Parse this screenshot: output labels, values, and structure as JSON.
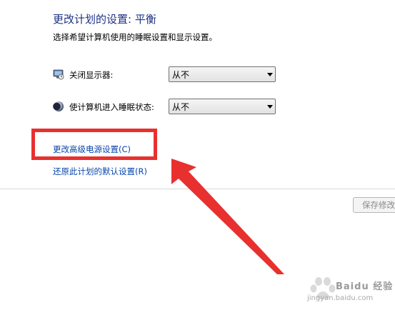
{
  "header": {
    "title": "更改计划的设置: 平衡",
    "description": "选择希望计算机使用的睡眠设置和显示设置。"
  },
  "settings": [
    {
      "label": "关闭显示器:",
      "icon": "monitor-clock-icon",
      "value": "从不"
    },
    {
      "label": "使计算机进入睡眠状态:",
      "icon": "moon-sleep-icon",
      "value": "从不"
    }
  ],
  "links": {
    "advanced": "更改高级电源设置(C)",
    "restore": "还原此计划的默认设置(R)"
  },
  "footer": {
    "save_label": "保存修改"
  },
  "watermark": {
    "brand": "Baidu 经验",
    "url": "jingyan.baidu.com"
  },
  "colors": {
    "title": "#1e3287",
    "link": "#0645ad",
    "highlight": "#e8302f"
  }
}
